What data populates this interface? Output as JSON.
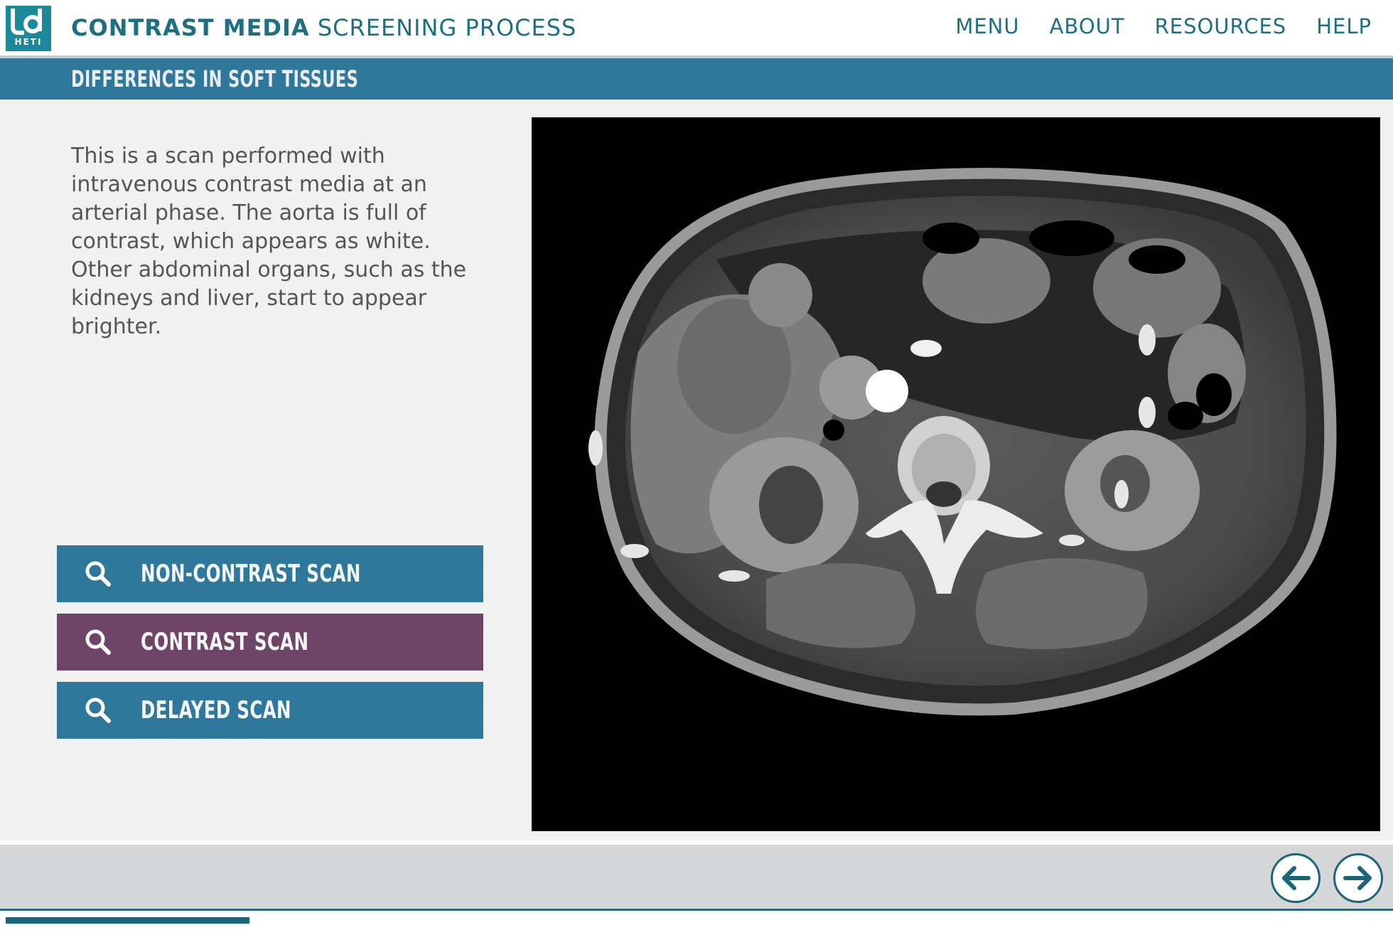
{
  "header": {
    "logo_text": "HETI",
    "title_bold": "CONTRAST MEDIA",
    "title_rest": "SCREENING PROCESS",
    "nav": [
      "MENU",
      "ABOUT",
      "RESOURCES",
      "HELP"
    ]
  },
  "section": {
    "title": "DIFFERENCES IN SOFT TISSUES"
  },
  "description": "This is a scan performed with intravenous contrast media at an arterial phase. The aorta is full of contrast, which appears as white. Other abdominal organs, such as the kidneys and liver, start to appear brighter.",
  "scan_buttons": [
    {
      "label": "NON-CONTRAST SCAN",
      "icon": "search-icon",
      "active": false
    },
    {
      "label": "CONTRAST SCAN",
      "icon": "search-icon",
      "active": true
    },
    {
      "label": "DELAYED SCAN",
      "icon": "search-icon",
      "active": false
    }
  ],
  "image": {
    "icon": "ct-scan-image"
  },
  "navigation": {
    "prev_icon": "arrow-left-icon",
    "next_icon": "arrow-right-icon"
  },
  "progress": {
    "fraction": 0.175
  },
  "colors": {
    "accent_teal": "#1f6f82",
    "banner_blue": "#2f779b",
    "active_purple": "#6e4467",
    "logo_teal": "#1a8a9a"
  }
}
